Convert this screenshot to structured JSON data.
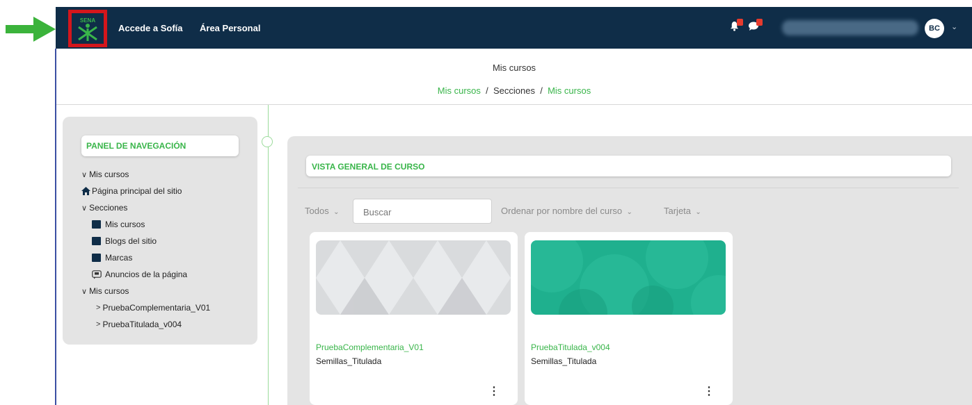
{
  "navbar": {
    "logo_text": "SENA",
    "links": [
      "Accede a Sofía",
      "Área Personal"
    ],
    "user_initials": "BC",
    "icons": [
      "bell-icon",
      "chat-icon",
      "chevron-down-icon"
    ],
    "colors": {
      "background": "#0f2d48",
      "brand_green": "#39b54a",
      "badge": "#e53b2e",
      "logo_highlight": "#d4161c"
    }
  },
  "page": {
    "title": "Mis cursos",
    "breadcrumb": [
      "Mis cursos",
      "Secciones",
      "Mis cursos"
    ]
  },
  "nav_panel": {
    "title": "PANEL DE NAVEGACIÓN",
    "items": [
      {
        "label": "Mis cursos",
        "icon": "chevron-down-icon"
      },
      {
        "label": "Página principal del sitio",
        "icon": "home-icon"
      },
      {
        "label": "Secciones",
        "icon": "chevron-down-icon"
      },
      {
        "label": "Mis cursos",
        "icon": "square-icon"
      },
      {
        "label": "Blogs del sitio",
        "icon": "square-icon"
      },
      {
        "label": "Marcas",
        "icon": "square-icon"
      },
      {
        "label": "Anuncios de la página",
        "icon": "forum-icon"
      },
      {
        "label": "Mis cursos",
        "icon": "chevron-down-icon"
      },
      {
        "label": "PruebaComplementaria_V01",
        "icon": "chevron-right-icon"
      },
      {
        "label": "PruebaTitulada_v004",
        "icon": "chevron-right-icon"
      }
    ]
  },
  "overview": {
    "title": "VISTA GENERAL DE CURSO",
    "filter_all": "Todos",
    "search_placeholder": "Buscar",
    "sort": "Ordenar por nombre del curso",
    "view": "Tarjeta",
    "courses": [
      {
        "name": "PruebaComplementaria_V01",
        "category": "Semillas_Titulada",
        "image_color": "#d7d9db"
      },
      {
        "name": "PruebaTitulada_v004",
        "category": "Semillas_Titulada",
        "image_color": "#1fb08e"
      }
    ]
  }
}
